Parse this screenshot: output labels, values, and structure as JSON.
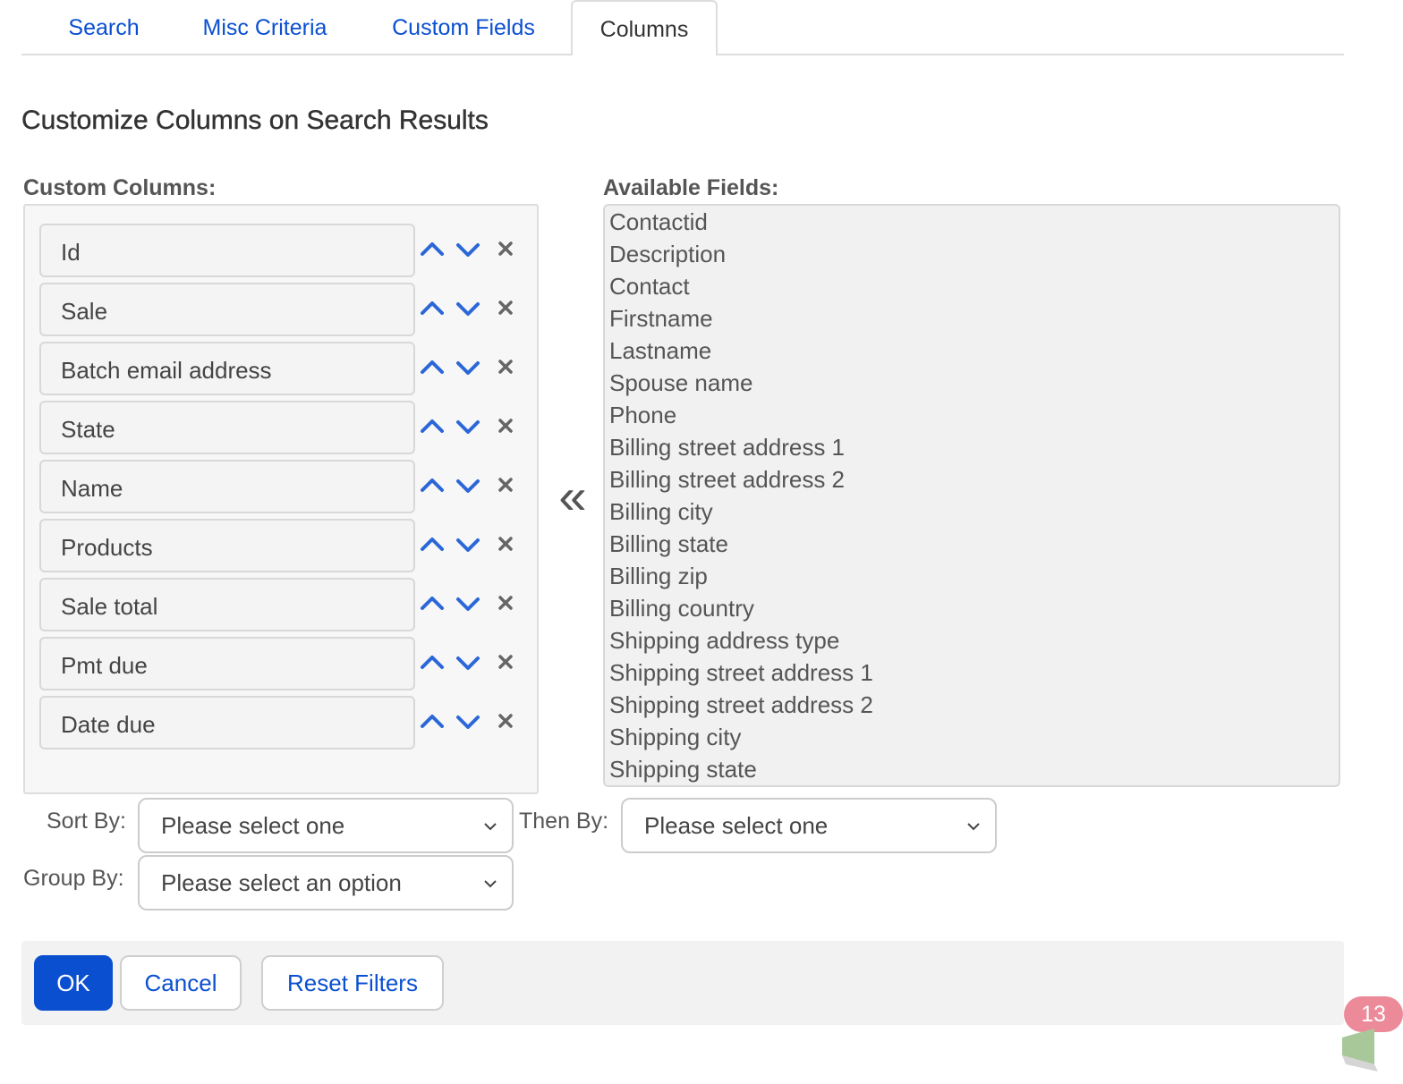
{
  "tabs": [
    {
      "label": "Search"
    },
    {
      "label": "Misc Criteria"
    },
    {
      "label": "Custom Fields"
    },
    {
      "label": "Columns"
    }
  ],
  "title": "Customize Columns on Search Results",
  "custom_columns": {
    "label": "Custom Columns:",
    "items": [
      "Id",
      "Sale",
      "Batch email address",
      "State",
      "Name",
      "Products",
      "Sale total",
      "Pmt due",
      "Date due"
    ]
  },
  "available_fields": {
    "label": "Available Fields:",
    "items": [
      "Contactid",
      "Description",
      "Contact",
      "Firstname",
      "Lastname",
      "Spouse name",
      "Phone",
      "Billing street address 1",
      "Billing street address 2",
      "Billing city",
      "Billing state",
      "Billing zip",
      "Billing country",
      "Shipping address type",
      "Shipping street address 1",
      "Shipping street address 2",
      "Shipping city",
      "Shipping state"
    ]
  },
  "transfer_icon": "double-chevron-left-icon",
  "sort": {
    "sort_by_label": "Sort By:",
    "sort_by_value": "Please select one",
    "then_by_label": "Then By:",
    "then_by_value": "Please select one",
    "group_by_label": "Group By:",
    "group_by_value": "Please select an option"
  },
  "buttons": {
    "ok": "OK",
    "cancel": "Cancel",
    "reset": "Reset Filters"
  },
  "badge": {
    "count": "13"
  },
  "colors": {
    "accent": "#0b4fd1",
    "badge": "#ec8a99"
  }
}
